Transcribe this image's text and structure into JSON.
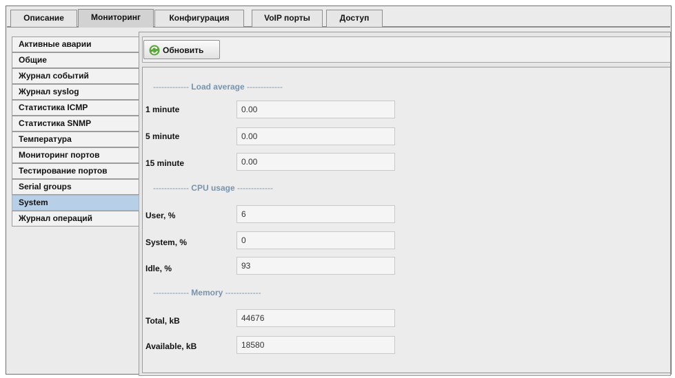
{
  "tabs": [
    {
      "label": "Описание"
    },
    {
      "label": "Мониторинг"
    },
    {
      "label": "Конфигурация"
    },
    {
      "label": "VoIP порты"
    },
    {
      "label": "Доступ"
    }
  ],
  "sidebar": {
    "items": [
      {
        "label": "Активные аварии"
      },
      {
        "label": "Общие"
      },
      {
        "label": "Журнал событий"
      },
      {
        "label": "Журнал syslog"
      },
      {
        "label": "Статистика ICMP"
      },
      {
        "label": "Статистика SNMP"
      },
      {
        "label": "Температура"
      },
      {
        "label": "Мониторинг портов"
      },
      {
        "label": "Тестирование портов"
      },
      {
        "label": "Serial groups"
      },
      {
        "label": "System"
      },
      {
        "label": "Журнал операций"
      }
    ]
  },
  "toolbar": {
    "refresh_label": "Обновить"
  },
  "load_average": {
    "title": "Load average",
    "one_minute_label": "1 minute",
    "one_minute_value": "0.00",
    "five_minute_label": "5 minute",
    "five_minute_value": "0.00",
    "fifteen_minute_label": "15 minute",
    "fifteen_minute_value": "0.00"
  },
  "cpu_usage": {
    "title": "CPU usage",
    "user_label": "User, %",
    "user_value": "6",
    "system_label": "System, %",
    "system_value": "0",
    "idle_label": "Idle, %",
    "idle_value": "93"
  },
  "memory": {
    "title": "Memory",
    "total_label": "Total, kB",
    "total_value": "44676",
    "available_label": "Available, kB",
    "available_value": "18580"
  }
}
